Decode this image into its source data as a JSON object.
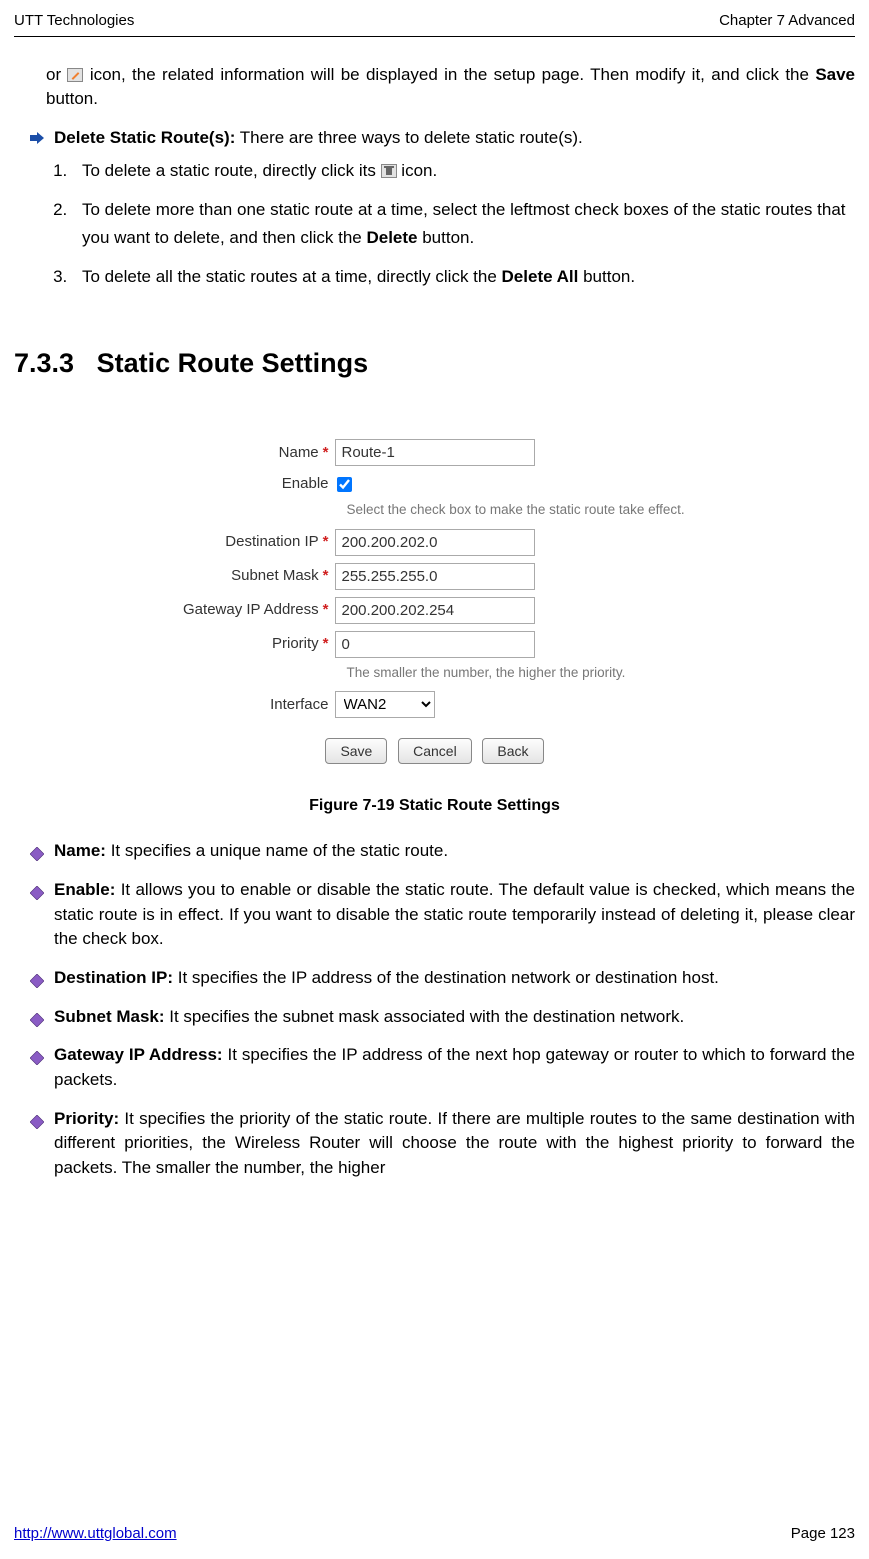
{
  "header": {
    "left": "UTT Technologies",
    "right": "Chapter 7 Advanced"
  },
  "intro": {
    "part1": "or ",
    "part2": " icon, the related information will be displayed in the setup page. Then modify it, and click the ",
    "bold": "Save",
    "part3": " button."
  },
  "delete": {
    "title": "Delete Static Route(s):",
    "text": " There are three ways to delete static route(s).",
    "item1a": "To delete a static route, directly click its ",
    "item1b": " icon.",
    "item2a": "To delete more than one static route at a time, select the leftmost check boxes of the static routes that you want to delete, and then click the ",
    "item2bold": "Delete",
    "item2b": " button.",
    "item3a": "To delete all the static routes at a time, directly click the ",
    "item3bold": "Delete All",
    "item3b": " button."
  },
  "section": {
    "number": "7.3.3",
    "title": "Static Route Settings"
  },
  "form": {
    "labels": {
      "name": "Name",
      "enable": "Enable",
      "destip": "Destination IP",
      "mask": "Subnet Mask",
      "gateway": "Gateway IP Address",
      "priority": "Priority",
      "interface": "Interface"
    },
    "values": {
      "name": "Route-1",
      "destip": "200.200.202.0",
      "mask": "255.255.255.0",
      "gateway": "200.200.202.254",
      "priority": "0",
      "interface": "WAN2"
    },
    "hints": {
      "enable": "Select the check box to make the static route take effect.",
      "priority": "The smaller the number, the higher the priority."
    },
    "buttons": {
      "save": "Save",
      "cancel": "Cancel",
      "back": "Back"
    }
  },
  "caption": "Figure 7-19 Static Route Settings",
  "defs": [
    {
      "term": "Name:",
      "text": " It specifies a unique name of the static route."
    },
    {
      "term": "Enable:",
      "text": " It allows you to enable or disable the static route. The default value is checked, which means the static route is in effect. If you want to disable the static route temporarily instead of deleting it, please clear the check box."
    },
    {
      "term": "Destination IP:",
      "text": " It specifies the IP address of the destination network or destination host."
    },
    {
      "term": "Subnet Mask:",
      "text": " It specifies the subnet mask associated with the destination network."
    },
    {
      "term": "Gateway IP Address:",
      "text": " It specifies the IP address of the next hop gateway or router to which to forward the packets."
    },
    {
      "term": "Priority:",
      "text": " It specifies the priority of the static route. If there are multiple routes to the same destination with different priorities, the Wireless Router will choose the route with the highest priority to forward the packets. The smaller the number, the higher"
    }
  ],
  "footer": {
    "url": "http://www.uttglobal.com",
    "page": "Page 123"
  }
}
